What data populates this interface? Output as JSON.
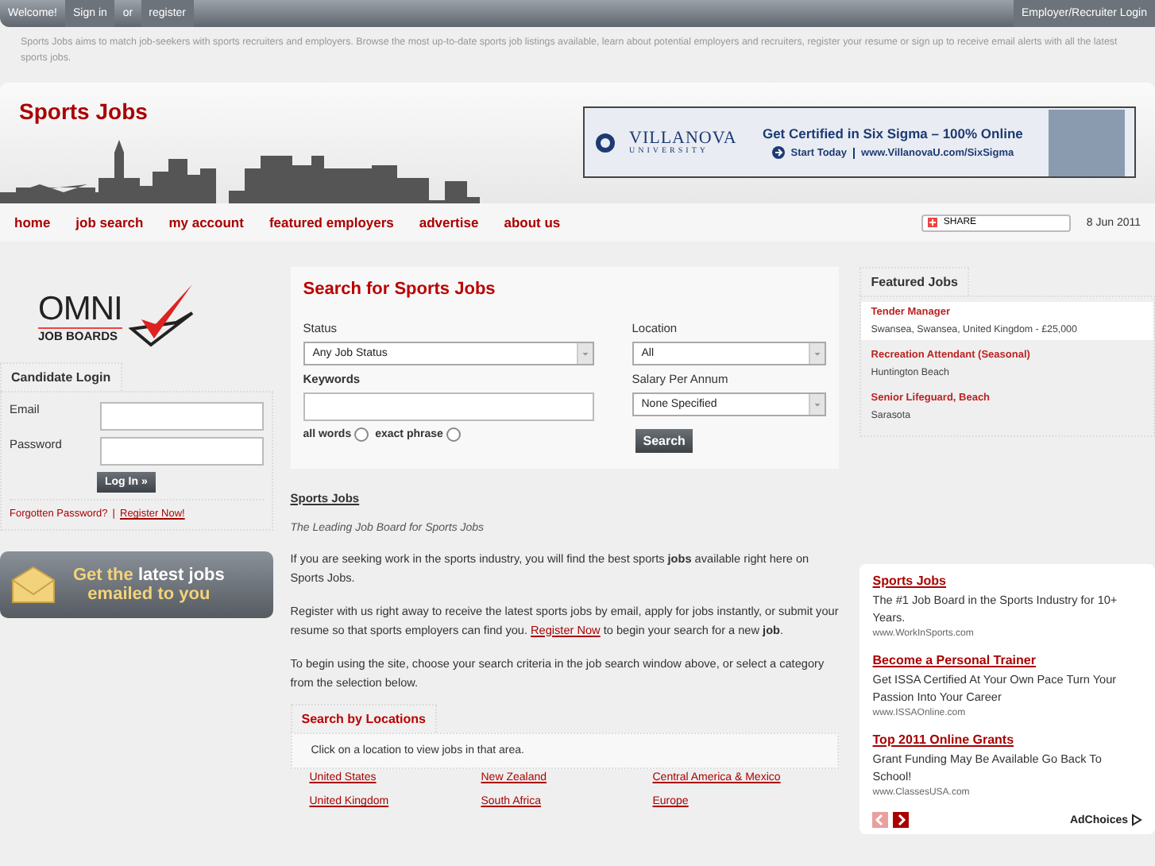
{
  "top_bar": {
    "welcome": "Welcome!",
    "sign_in": "Sign in",
    "or": "or",
    "register": "register",
    "employer_login": "Employer/Recruiter Login"
  },
  "intro": "Sports Jobs aims to match job-seekers with sports recruiters and employers.  Browse the most up-to-date sports job listings available, learn about potential employers and recruiters, register your resume or sign up to receive email alerts with all the latest sports jobs.",
  "header": {
    "site_title": "Sports Jobs",
    "ad": {
      "logo_top": "VILLANOVA",
      "logo_bottom": "UNIVERSITY",
      "headline": "Get Certified in Six Sigma – 100% Online",
      "cta": "Start Today",
      "url": "www.VillanovaU.com/SixSigma"
    }
  },
  "nav": {
    "items": [
      {
        "label": "home"
      },
      {
        "label": "job search"
      },
      {
        "label": "my account"
      },
      {
        "label": "featured employers"
      },
      {
        "label": "advertise"
      },
      {
        "label": "about us"
      }
    ],
    "share": "SHARE",
    "date": "8 Jun 2011"
  },
  "sidebar": {
    "logo_top": "OMNI",
    "logo_bottom": "JOB BOARDS",
    "login": {
      "title": "Candidate Login",
      "email_label": "Email",
      "password_label": "Password",
      "button": "Log In »",
      "forgot": "Forgotten Password?",
      "separator": "|",
      "register": "Register Now!"
    },
    "banner": {
      "line1_a": "Get the",
      "line1_b": "latest jobs",
      "line2": "emailed to you"
    }
  },
  "search": {
    "title": "Search for Sports Jobs",
    "status_label": "Status",
    "status_value": "Any Job Status",
    "location_label": "Location",
    "location_value": "All",
    "keywords_label": "Keywords",
    "salary_label": "Salary Per Annum",
    "salary_value": "None Specified",
    "match_options": [
      {
        "label": "all words",
        "selected": false
      },
      {
        "label": "exact phrase",
        "selected": false
      }
    ],
    "button": "Search"
  },
  "content": {
    "heading": "Sports Jobs",
    "tagline": "The Leading Job Board for Sports Jobs",
    "paragraphs": [
      {
        "before": "If you are seeking work in the sports industry, you will find the best sports **jobs** available right here on Sports Jobs."
      },
      {
        "before": "Register with us right away to receive the latest sports jobs by email, apply for jobs instantly, or submit your resume so that sports employers can find you. ",
        "link": "Register Now",
        "after": " to begin your search for a new **job**."
      },
      {
        "before": "To begin using the site, choose your search criteria in the job search window above, or select a category from the selection below."
      }
    ]
  },
  "locations": {
    "tab": "Search by Locations",
    "hint": "Click on a location to view jobs in that area.",
    "items": [
      "United States",
      "New Zealand",
      "Central America & Mexico",
      "United Kingdom",
      "South Africa",
      "Europe"
    ]
  },
  "featured_jobs": {
    "title": "Featured Jobs",
    "items": [
      {
        "title": "Tender Manager",
        "detail": "Swansea, Swansea, United Kingdom - £25,000",
        "highlighted": true
      },
      {
        "title": "Recreation Attendant (Seasonal)",
        "detail": "Huntington Beach",
        "highlighted": false
      },
      {
        "title": "Senior Lifeguard, Beach",
        "detail": "Sarasota",
        "highlighted": false
      }
    ]
  },
  "ads": {
    "items": [
      {
        "title": "Sports Jobs",
        "text": "The #1 Job Board in the Sports Industry for 10+ Years.",
        "url": "www.WorkInSports.com"
      },
      {
        "title": "Become a Personal Trainer",
        "text": "Get ISSA Certified At Your Own Pace Turn Your Passion Into Your Career",
        "url": "www.ISSAOnline.com"
      },
      {
        "title": "Top 2011 Online Grants",
        "text": "Grant Funding May Be Available Go Back To School!",
        "url": "www.ClassesUSA.com"
      }
    ],
    "adchoices": "AdChoices"
  }
}
